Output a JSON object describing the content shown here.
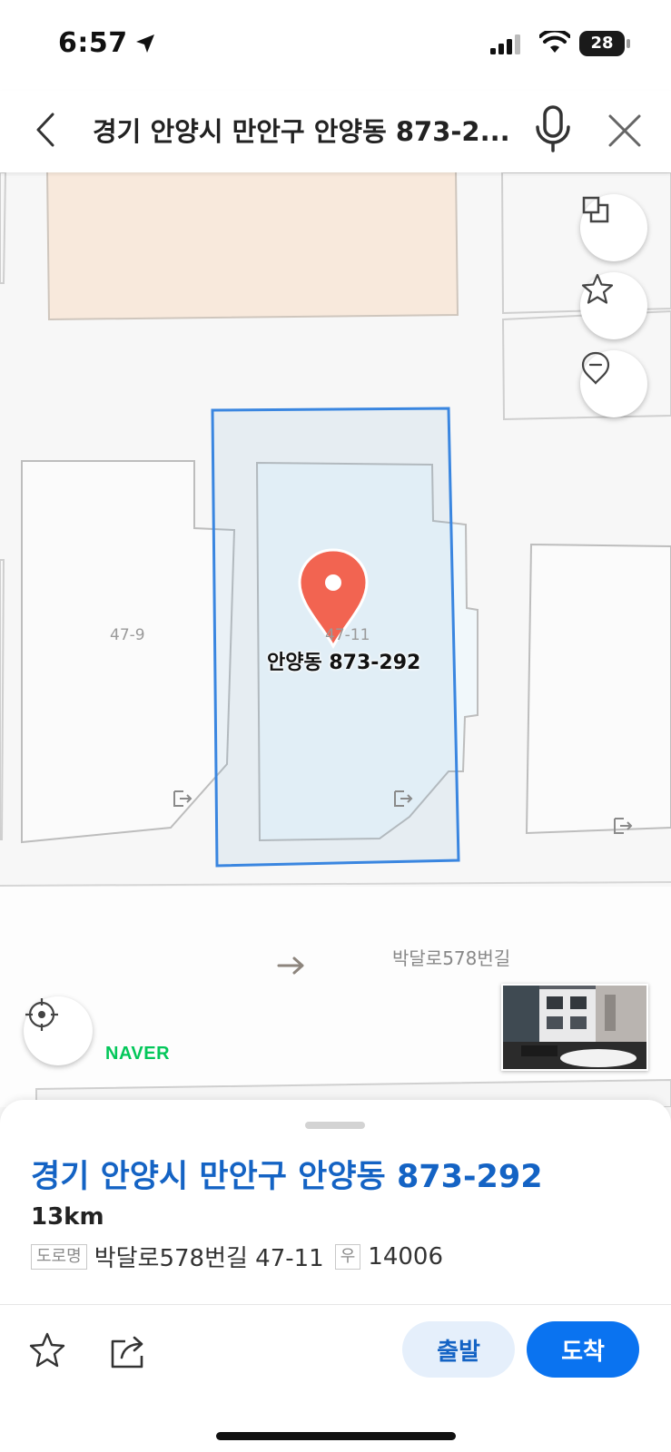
{
  "status_bar": {
    "time": "6:57",
    "battery": "28"
  },
  "search": {
    "query": "경기 안양시 만안구 안양동 873-2..."
  },
  "map": {
    "parcel_labels": [
      "47-9",
      "47-11"
    ],
    "pin_label": "안양동 873-292",
    "street_label": "박달로578번길",
    "logo": "NAVER",
    "icons": [
      "layers-icon",
      "star-icon",
      "pin-outline-icon",
      "current-location-icon"
    ]
  },
  "sheet": {
    "title": "경기 안양시 만안구 안양동 873-292",
    "distance": "13km",
    "road_tag": "도로명",
    "road_address": "박달로578번길 47-11",
    "postal_tag": "우",
    "postal_code": "14006",
    "depart_label": "출발",
    "arrive_label": "도착"
  },
  "colors": {
    "accent": "#1463c4",
    "primary_button": "#0a73f0",
    "pin": "#f26451",
    "naver_green": "#03c75a",
    "parcel_outline": "#3a86e0"
  }
}
